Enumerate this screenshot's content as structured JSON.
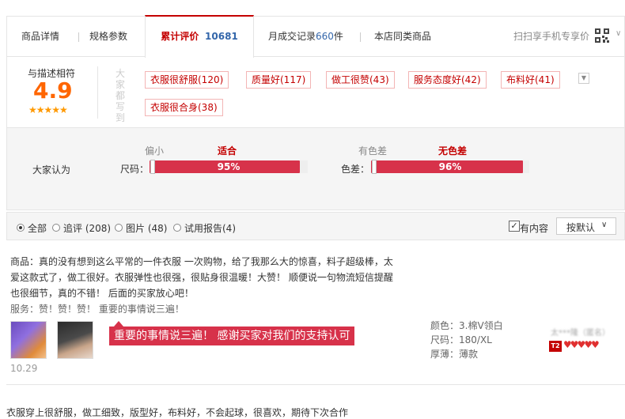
{
  "tabs": [
    {
      "label": "商品详情"
    },
    {
      "label": "规格参数"
    },
    {
      "label": "累计评价",
      "count": "10681"
    },
    {
      "label": "月成交记录",
      "count": "660",
      "suffix": "件"
    },
    {
      "label": "本店同类商品"
    }
  ],
  "mobile_scan_label": "扫扫享手机专享价",
  "rating": {
    "desc_label": "与描述相符",
    "score": "4.9",
    "stars": "★★★★★",
    "vertical_label": "大家都写到"
  },
  "tags": [
    {
      "label": "衣服很舒服(120)"
    },
    {
      "label": "质量好(117)"
    },
    {
      "label": "做工很赞(43)"
    },
    {
      "label": "服务态度好(42)"
    },
    {
      "label": "布料好(41)"
    },
    {
      "label": "衣服很合身(38)"
    }
  ],
  "fit": {
    "label": "大家认为",
    "size": {
      "name": "尺码：",
      "left": "偏小",
      "center": "适合",
      "percent_label": "95%",
      "percent": 95
    },
    "color": {
      "name": "色差：",
      "left": "有色差",
      "center": "无色差",
      "percent_label": "96%",
      "percent": 96
    }
  },
  "filters": {
    "options": [
      {
        "label": "全部",
        "checked": true
      },
      {
        "label": "追评 (208)",
        "checked": false
      },
      {
        "label": "图片 (48)",
        "checked": false
      },
      {
        "label": "试用报告(4)",
        "checked": false
      }
    ],
    "has_content_label": "有内容",
    "sort_label": "按默认"
  },
  "review1": {
    "lines": [
      "商品：真的没有想到这么平常的一件衣服 一次购物，给了我那么大的惊喜，料子超级棒，太",
      "爱这款式了，做工很好。衣服弹性也很强，很贴身很温暖！大赞！ 顺便说一句物流短信提醒",
      "也很细节，真的不错！ 后面的买家放心吧！"
    ],
    "service_line": "服务：赞！赞！赞！ 重要的事情说三遍！",
    "bubble": "重要的事情说三遍！  感谢买家对我们的支持认可",
    "date": "10.29",
    "spec_color": "颜色：3.棉V领白",
    "spec_size": "尺码：180/XL",
    "spec_thickness": "厚薄：薄款",
    "user": "太***隆（匿名）",
    "level_badge": "T2"
  },
  "review2": {
    "text": "衣服穿上很舒服，做工细致，版型好，布料好，不会起球，很喜欢，期待下次合作"
  }
}
